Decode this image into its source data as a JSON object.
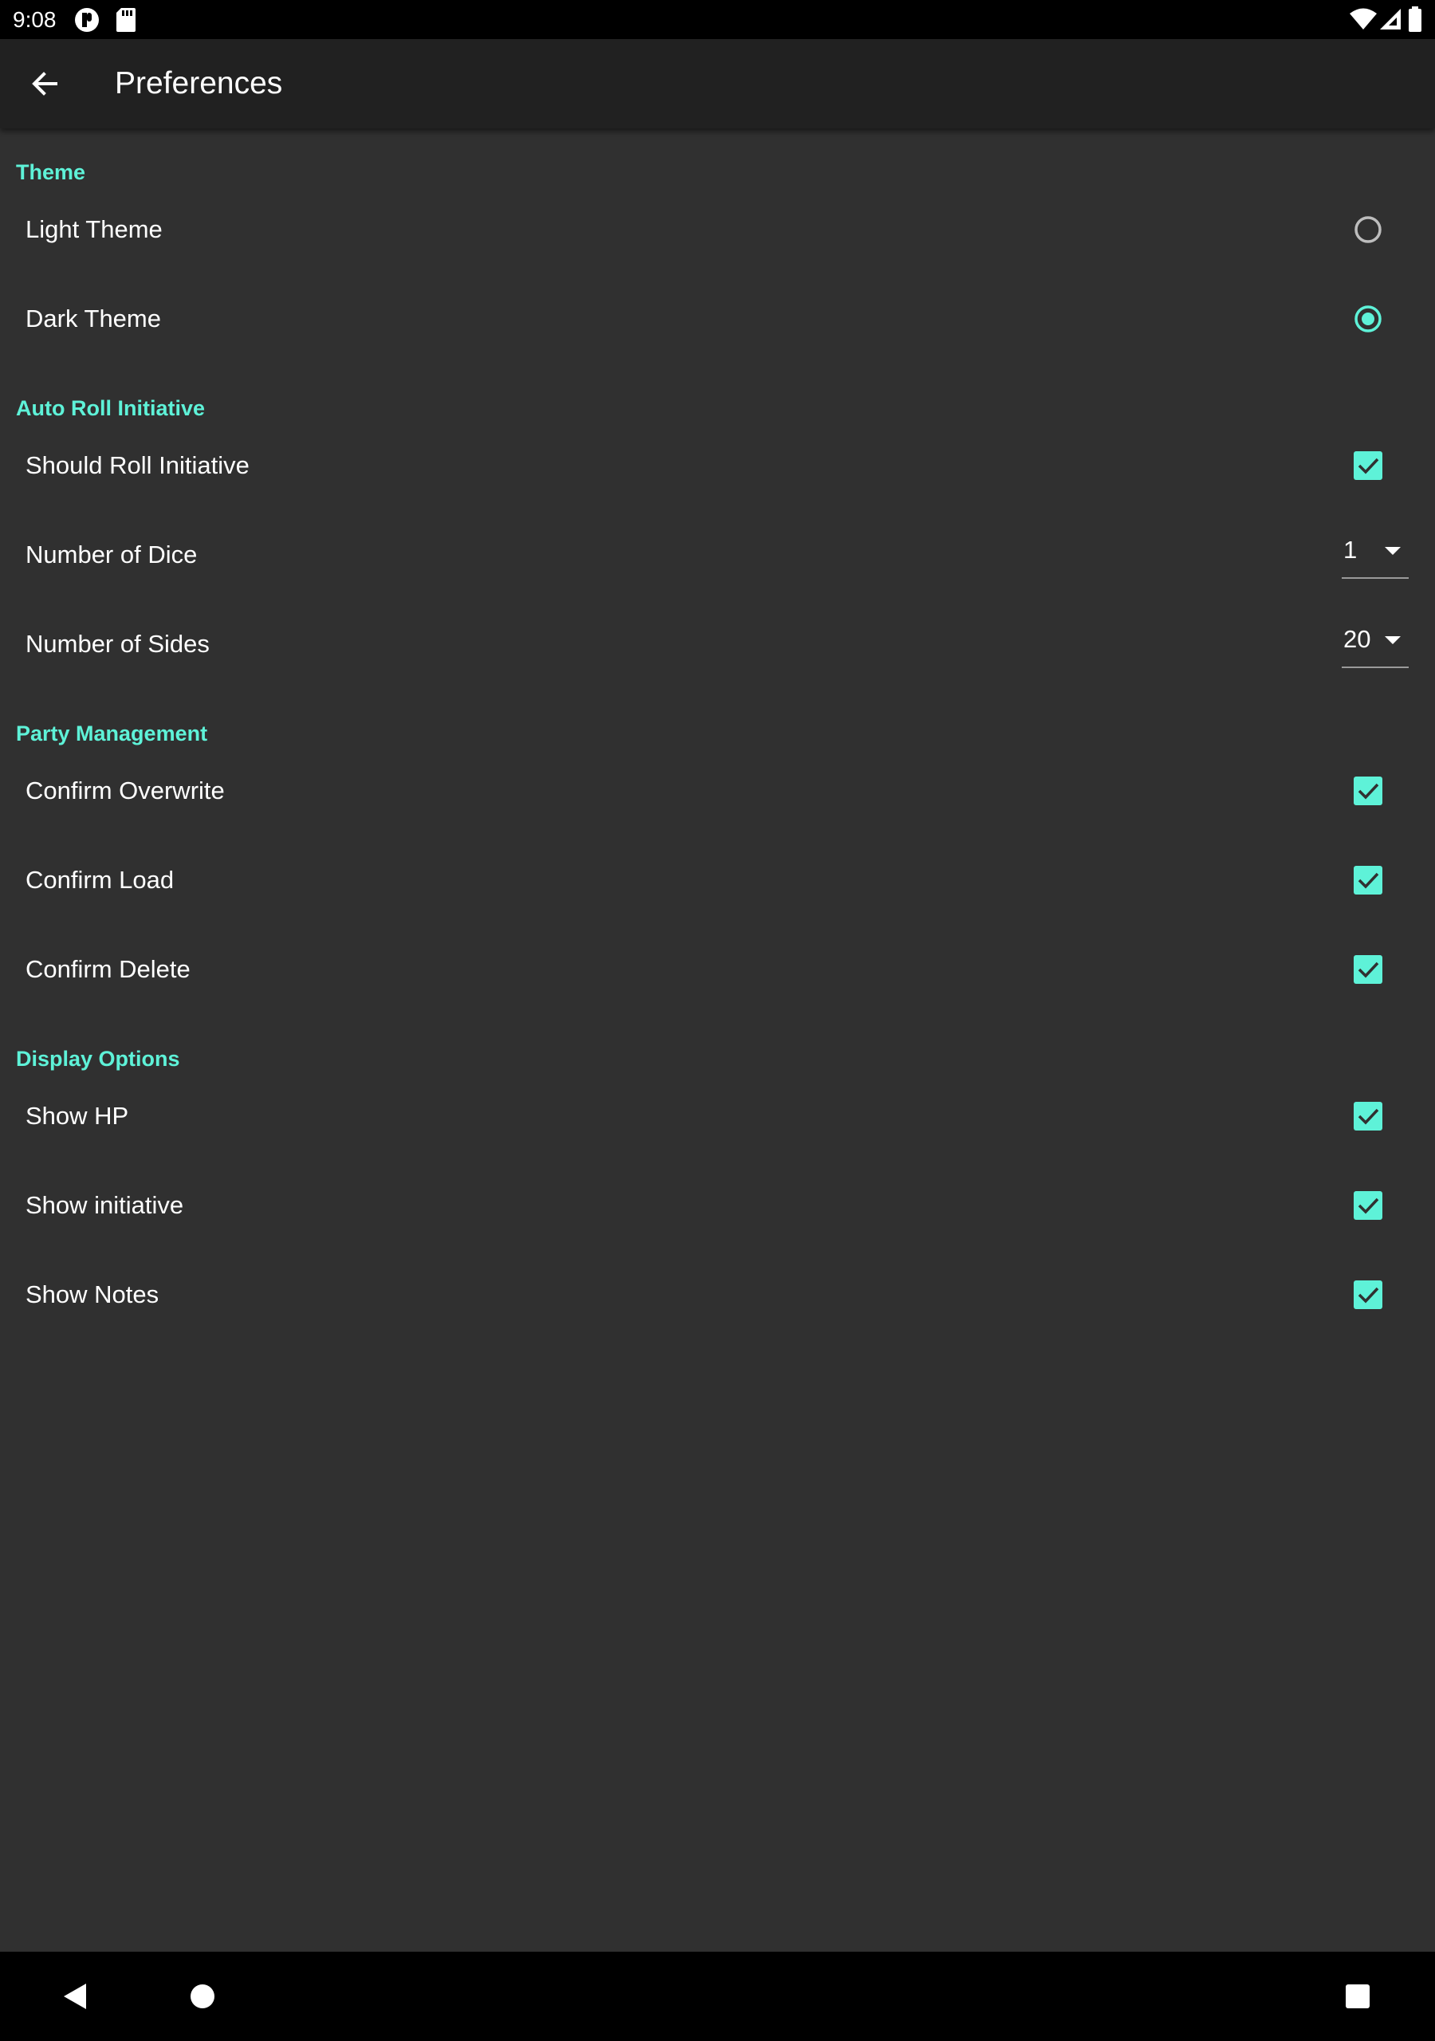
{
  "status_bar": {
    "time": "9:08",
    "icons": [
      "app-notification-icon",
      "sd-card-icon",
      "wifi-icon",
      "cell-signal-icon",
      "battery-icon"
    ]
  },
  "app_bar": {
    "title": "Preferences",
    "back_icon": "arrow-back-icon"
  },
  "colors": {
    "accent": "#5ef2d8",
    "background": "#303030",
    "app_bar": "#212121",
    "text": "#ffffff"
  },
  "sections": {
    "theme": {
      "title": "Theme",
      "light": {
        "label": "Light Theme",
        "selected": false
      },
      "dark": {
        "label": "Dark Theme",
        "selected": true
      }
    },
    "auto_roll": {
      "title": "Auto Roll Initiative",
      "should_roll": {
        "label": "Should Roll Initiative",
        "checked": true
      },
      "num_dice": {
        "label": "Number of Dice",
        "value": "1"
      },
      "num_sides": {
        "label": "Number of Sides",
        "value": "20"
      }
    },
    "party": {
      "title": "Party Management",
      "confirm_overwrite": {
        "label": "Confirm Overwrite",
        "checked": true
      },
      "confirm_load": {
        "label": "Confirm Load",
        "checked": true
      },
      "confirm_delete": {
        "label": "Confirm Delete",
        "checked": true
      }
    },
    "display": {
      "title": "Display Options",
      "show_hp": {
        "label": "Show HP",
        "checked": true
      },
      "show_initiative": {
        "label": "Show initiative",
        "checked": true
      },
      "show_notes": {
        "label": "Show Notes",
        "checked": true
      }
    }
  },
  "nav_bar": {
    "icons": [
      "nav-back-icon",
      "nav-home-icon",
      "nav-recents-icon"
    ]
  }
}
